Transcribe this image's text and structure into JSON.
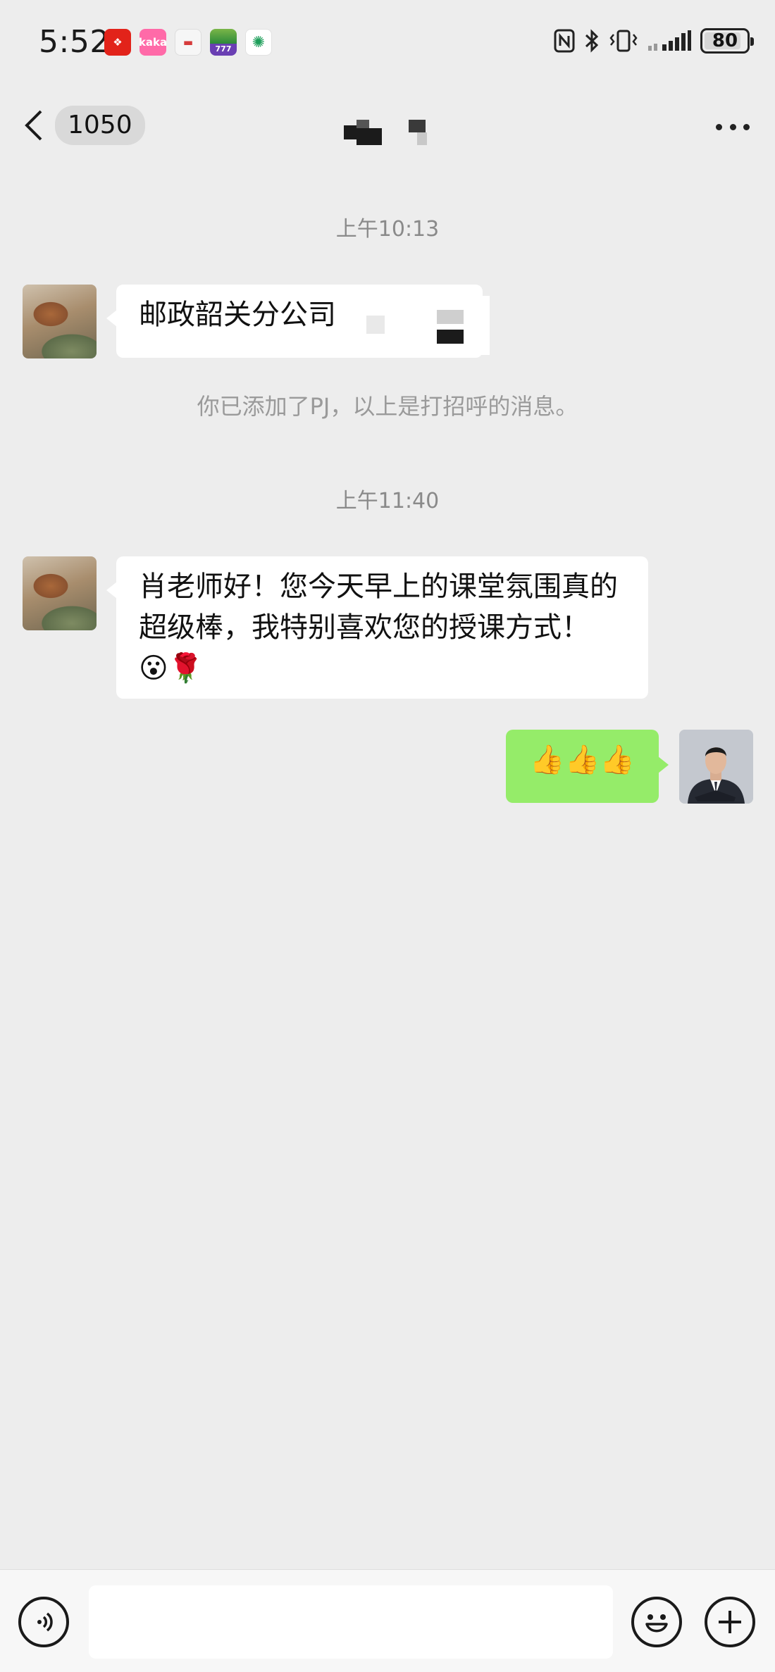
{
  "status_bar": {
    "time": "5:52",
    "app_icons": [
      "lottery-app-icon",
      "kaka-app-icon",
      "calendar-app-icon",
      "game-app-icon",
      "china-mobile-app-icon"
    ],
    "app_icon_text": [
      "",
      "kaka",
      "",
      "777",
      ""
    ],
    "battery": "80",
    "battery_level": 0.8
  },
  "nav": {
    "unread_count": "1050",
    "more_label": "···"
  },
  "messages": {
    "ts1": "上午10:13",
    "msg1": "邮政韶关分公司",
    "system_notice": "你已添加了PJ，以上是打招呼的消息。",
    "ts2": "上午11:40",
    "msg2": "肖老师好！您今天早上的课堂氛围真的超级棒，我特别喜欢您的授课方式！",
    "msg2_emoji": "😮🌹",
    "msg3": "👍👍👍"
  },
  "input_bar": {
    "voice_icon": "voice-icon",
    "emoji_icon": "emoji-icon",
    "plus_icon": "plus-icon",
    "placeholder": ""
  },
  "colors": {
    "background": "#ededed",
    "incoming_bubble": "#ffffff",
    "outgoing_bubble": "#95ec69",
    "timestamp_text": "#8a8a8a"
  }
}
